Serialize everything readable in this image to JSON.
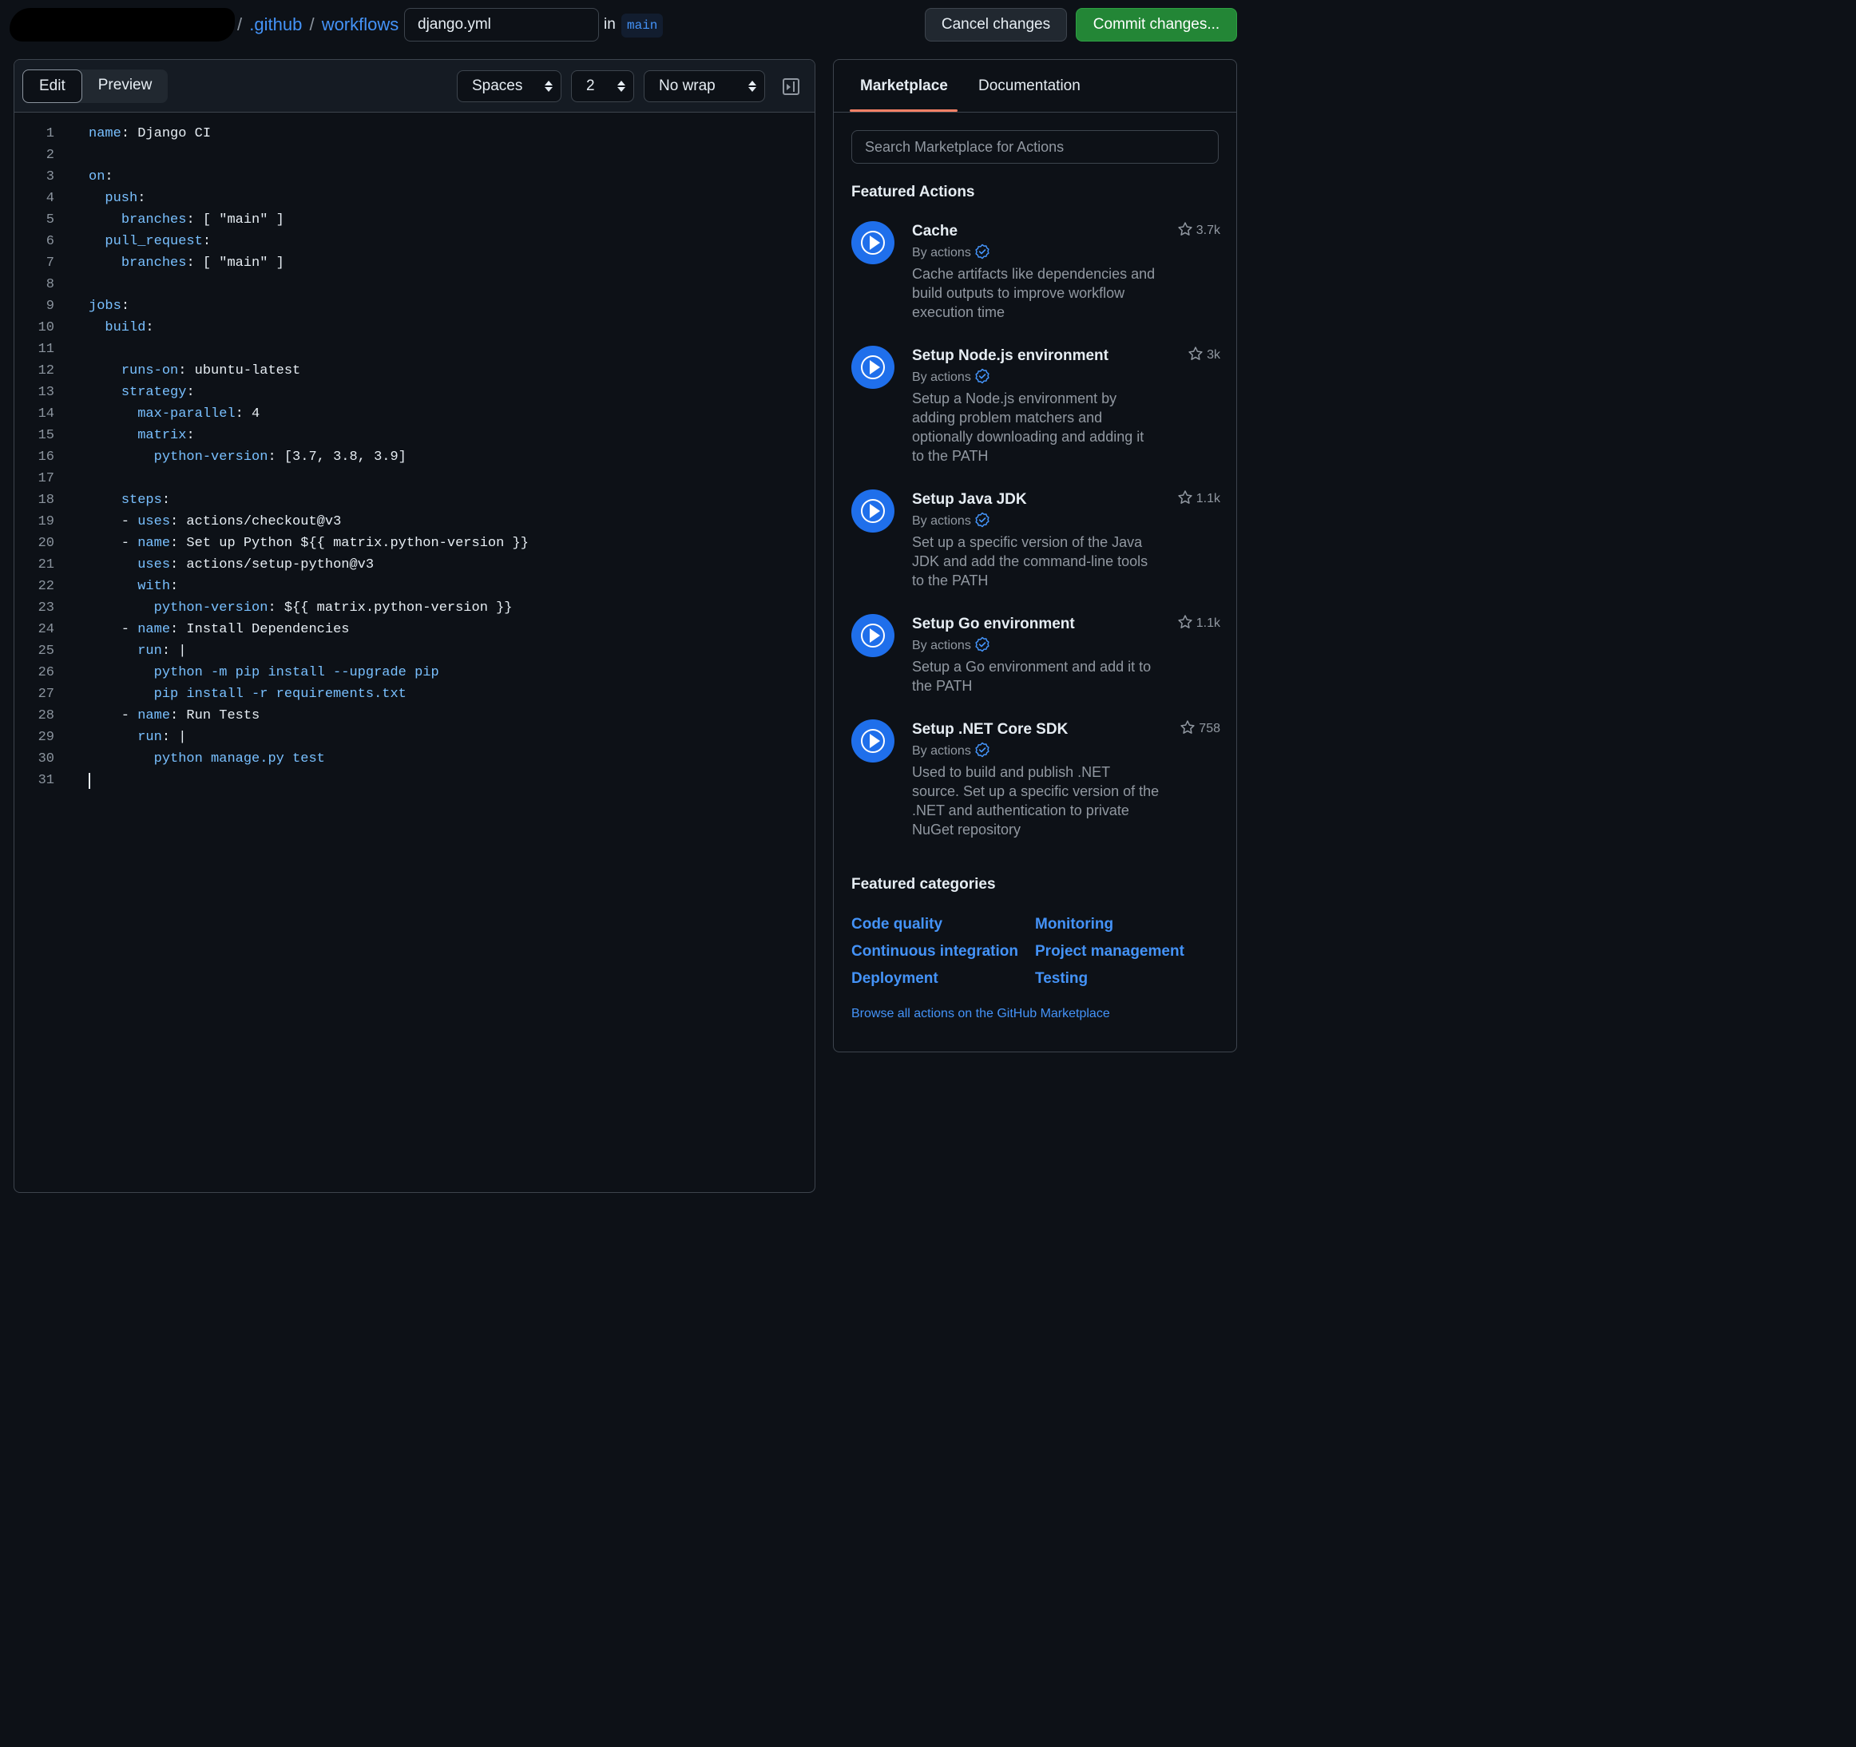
{
  "header": {
    "breadcrumbs": [
      ".github",
      "workflows"
    ],
    "separator": "/",
    "filename": "django.yml",
    "in_label": "in",
    "branch": "main",
    "cancel_label": "Cancel changes",
    "commit_label": "Commit changes..."
  },
  "editor": {
    "tabs": [
      "Edit",
      "Preview"
    ],
    "active_tab": "Edit",
    "indent_mode": "Spaces",
    "indent_size": "2",
    "wrap_mode": "No wrap",
    "lines": [
      {
        "indent": "",
        "key": "name",
        "rest": ": Django CI"
      },
      {
        "indent": "",
        "key": "",
        "rest": ""
      },
      {
        "indent": "",
        "key": "on",
        "rest": ":"
      },
      {
        "indent": "  ",
        "key": "push",
        "rest": ":"
      },
      {
        "indent": "    ",
        "key": "branches",
        "rest": ": [ \"main\" ]"
      },
      {
        "indent": "  ",
        "key": "pull_request",
        "rest": ":"
      },
      {
        "indent": "    ",
        "key": "branches",
        "rest": ": [ \"main\" ]"
      },
      {
        "indent": "",
        "key": "",
        "rest": ""
      },
      {
        "indent": "",
        "key": "jobs",
        "rest": ":"
      },
      {
        "indent": "  ",
        "key": "build",
        "rest": ":"
      },
      {
        "indent": "",
        "key": "",
        "rest": ""
      },
      {
        "indent": "    ",
        "key": "runs-on",
        "rest": ": ubuntu-latest"
      },
      {
        "indent": "    ",
        "key": "strategy",
        "rest": ":"
      },
      {
        "indent": "      ",
        "key": "max-parallel",
        "rest": ": 4"
      },
      {
        "indent": "      ",
        "key": "matrix",
        "rest": ":"
      },
      {
        "indent": "        ",
        "key": "python-version",
        "rest": ": [3.7, 3.8, 3.9]"
      },
      {
        "indent": "",
        "key": "",
        "rest": ""
      },
      {
        "indent": "    ",
        "key": "steps",
        "rest": ":"
      },
      {
        "indent": "    - ",
        "key": "uses",
        "rest": ": actions/checkout@v3"
      },
      {
        "indent": "    - ",
        "key": "name",
        "rest": ": Set up Python ${{ matrix.python-version }}"
      },
      {
        "indent": "      ",
        "key": "uses",
        "rest": ": actions/setup-python@v3"
      },
      {
        "indent": "      ",
        "key": "with",
        "rest": ":"
      },
      {
        "indent": "        ",
        "key": "python-version",
        "rest": ": ${{ matrix.python-version }}"
      },
      {
        "indent": "    - ",
        "key": "name",
        "rest": ": Install Dependencies"
      },
      {
        "indent": "      ",
        "key": "run",
        "rest": ": |"
      },
      {
        "indent": "        ",
        "key": "python -m pip install --upgrade pip",
        "rest": ""
      },
      {
        "indent": "        ",
        "key": "pip install -r requirements.txt",
        "rest": ""
      },
      {
        "indent": "    - ",
        "key": "name",
        "rest": ": Run Tests"
      },
      {
        "indent": "      ",
        "key": "run",
        "rest": ": |"
      },
      {
        "indent": "        ",
        "key": "python manage.py test",
        "rest": ""
      },
      {
        "indent": "",
        "key": "",
        "rest": ""
      }
    ]
  },
  "sidebar": {
    "tabs": [
      "Marketplace",
      "Documentation"
    ],
    "active_tab": "Marketplace",
    "search_placeholder": "Search Marketplace for Actions",
    "featured_actions_heading": "Featured Actions",
    "actions": [
      {
        "title": "Cache",
        "by": "By actions",
        "stars": "3.7k",
        "description": "Cache artifacts like dependencies and build outputs to improve workflow execution time"
      },
      {
        "title": "Setup Node.js environment",
        "by": "By actions",
        "stars": "3k",
        "description": "Setup a Node.js environment by adding problem matchers and optionally downloading and adding it to the PATH"
      },
      {
        "title": "Setup Java JDK",
        "by": "By actions",
        "stars": "1.1k",
        "description": "Set up a specific version of the Java JDK and add the command-line tools to the PATH"
      },
      {
        "title": "Setup Go environment",
        "by": "By actions",
        "stars": "1.1k",
        "description": "Setup a Go environment and add it to the PATH"
      },
      {
        "title": "Setup .NET Core SDK",
        "by": "By actions",
        "stars": "758",
        "description": "Used to build and publish .NET source. Set up a specific version of the .NET and authentication to private NuGet repository"
      }
    ],
    "featured_categories_heading": "Featured categories",
    "categories": [
      "Code quality",
      "Monitoring",
      "Continuous integration",
      "Project management",
      "Deployment",
      "Testing"
    ],
    "browse_link": "Browse all actions on the GitHub Marketplace"
  },
  "colors": {
    "background": "#0d1117",
    "accent_link": "#4493f8",
    "commit_green": "#238636",
    "yaml_key": "#79c0ff",
    "tab_underline": "#f78166",
    "action_icon_blue": "#1f6feb"
  }
}
